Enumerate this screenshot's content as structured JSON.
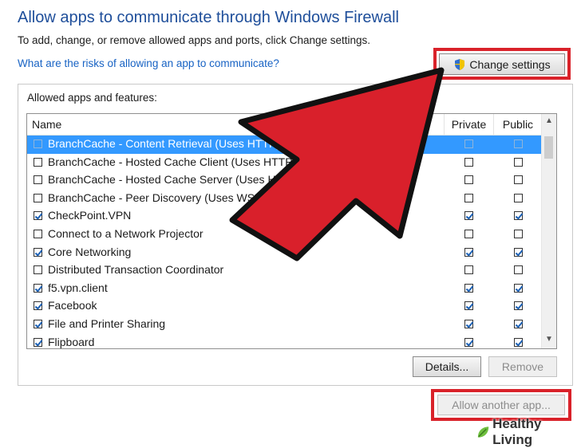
{
  "header": {
    "title": "Allow apps to communicate through Windows Firewall",
    "subtitle": "To add, change, or remove allowed apps and ports, click Change settings.",
    "risk_link": "What are the risks of allowing an app to communicate?",
    "change_settings_label": "Change settings"
  },
  "group": {
    "label": "Allowed apps and features:",
    "columns": {
      "name": "Name",
      "private": "Private",
      "public": "Public"
    },
    "rows": [
      {
        "name": "BranchCache - Content Retrieval (Uses HTTP)",
        "checked": false,
        "private": false,
        "public": false
      },
      {
        "name": "BranchCache - Hosted Cache Client (Uses HTTPS)",
        "checked": false,
        "private": false,
        "public": false
      },
      {
        "name": "BranchCache - Hosted Cache Server (Uses HTTPS)",
        "checked": false,
        "private": false,
        "public": false
      },
      {
        "name": "BranchCache - Peer Discovery (Uses WSD)",
        "checked": false,
        "private": false,
        "public": false
      },
      {
        "name": "CheckPoint.VPN",
        "checked": true,
        "private": true,
        "public": true
      },
      {
        "name": "Connect to a Network Projector",
        "checked": false,
        "private": false,
        "public": false
      },
      {
        "name": "Core Networking",
        "checked": true,
        "private": true,
        "public": true
      },
      {
        "name": "Distributed Transaction Coordinator",
        "checked": false,
        "private": false,
        "public": false
      },
      {
        "name": "f5.vpn.client",
        "checked": true,
        "private": true,
        "public": true
      },
      {
        "name": "Facebook",
        "checked": true,
        "private": true,
        "public": true
      },
      {
        "name": "File and Printer Sharing",
        "checked": true,
        "private": true,
        "public": true
      },
      {
        "name": "Flipboard",
        "checked": true,
        "private": true,
        "public": true
      }
    ],
    "details_label": "Details...",
    "remove_label": "Remove"
  },
  "footer": {
    "allow_another_label": "Allow another app...",
    "watermark": "Healthy Living"
  },
  "colors": {
    "title": "#1e4e9a",
    "link": "#1863c4",
    "highlight": "#d9222a",
    "selection": "#3399ff"
  }
}
